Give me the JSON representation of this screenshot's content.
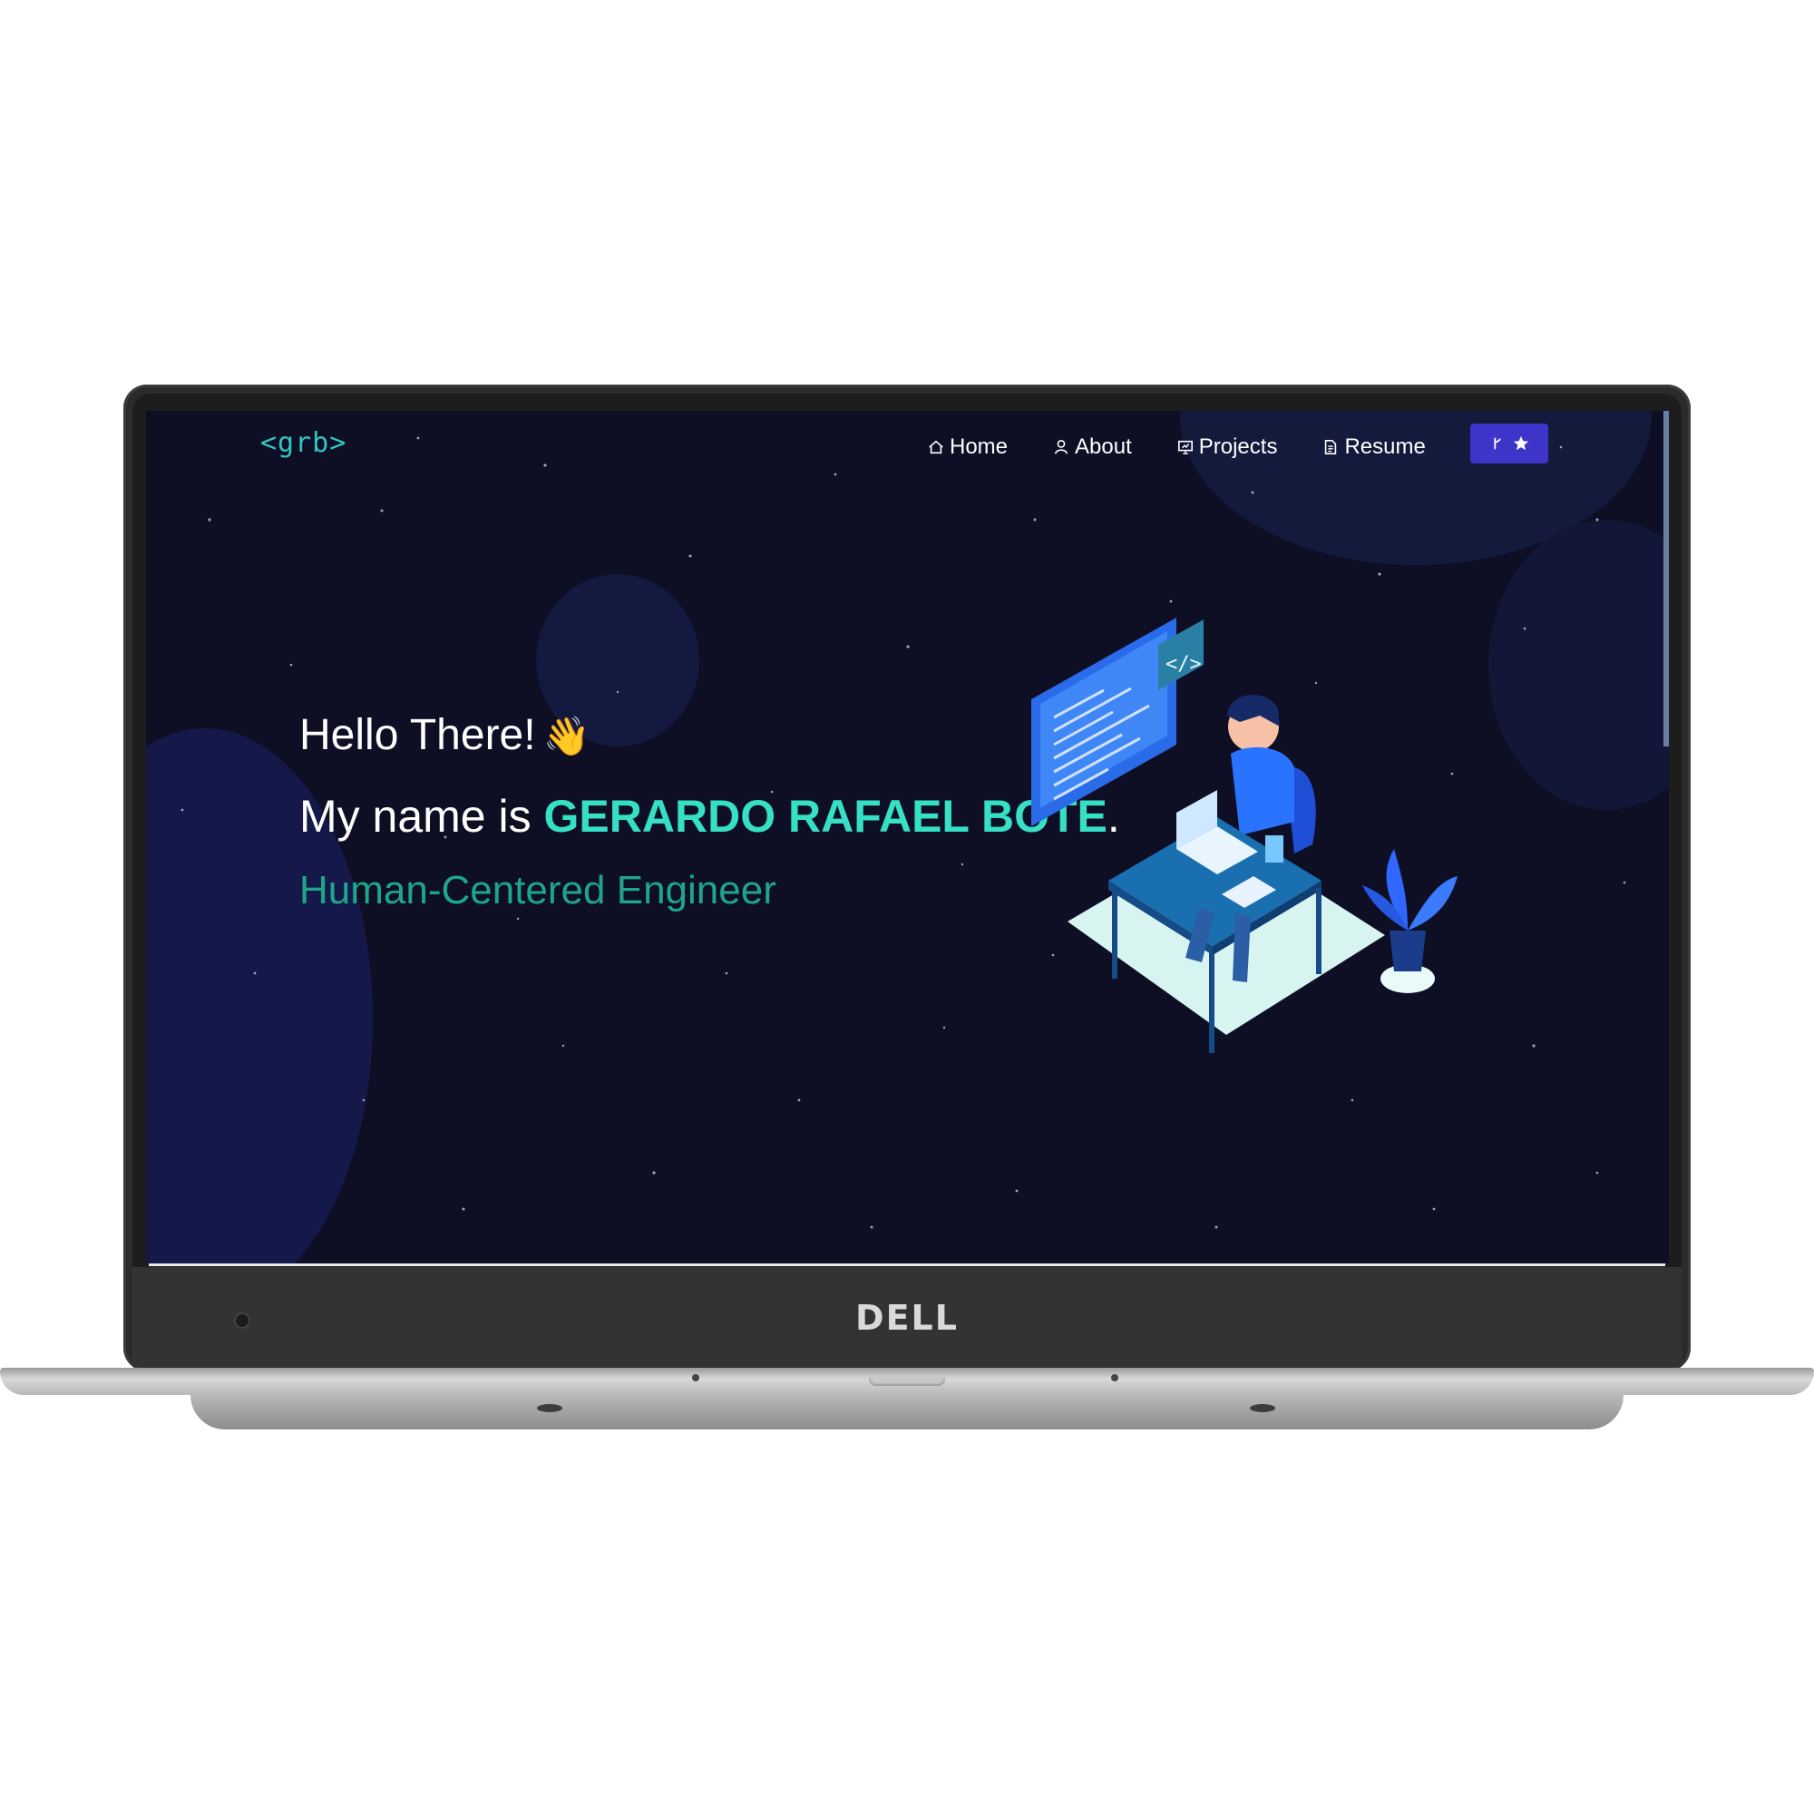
{
  "device": {
    "brand": "DELL"
  },
  "site": {
    "logo": "<grb>",
    "nav": {
      "items": [
        {
          "label": "Home",
          "icon": "home-icon"
        },
        {
          "label": "About",
          "icon": "user-icon"
        },
        {
          "label": "Projects",
          "icon": "presentation-icon"
        },
        {
          "label": "Resume",
          "icon": "document-icon"
        }
      ],
      "github_button": {
        "icons": [
          "git-fork-icon",
          "star-icon"
        ]
      }
    },
    "hero": {
      "greeting": "Hello There!",
      "wave_emoji": "👋",
      "intro_prefix": "My name is ",
      "name": "GERARDO RAFAEL BOTE",
      "intro_suffix": ".",
      "role": "Human-Centered Engineer"
    }
  },
  "colors": {
    "background": "#0e0f25",
    "accent_name": "#35e0c4",
    "accent_role": "#1ea58a",
    "logo": "#32c5c0",
    "button": "#3d35c9"
  }
}
